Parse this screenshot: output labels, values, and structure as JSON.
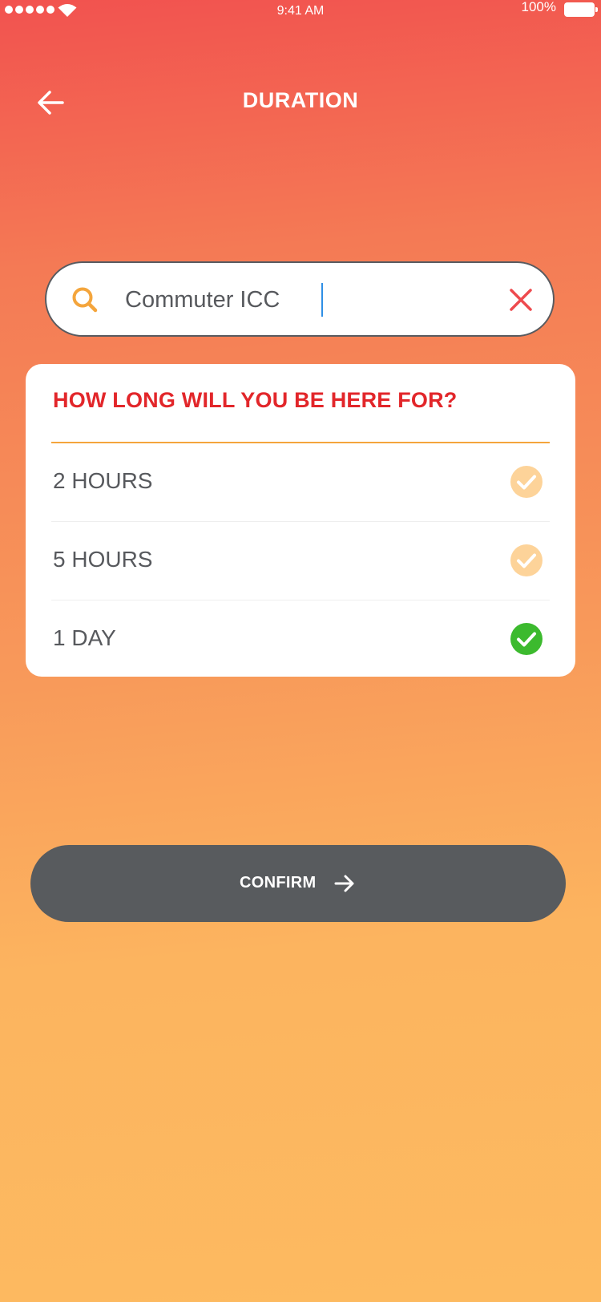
{
  "status_bar": {
    "time": "9:41 AM",
    "battery": "100%"
  },
  "header": {
    "title": "DURATION",
    "back_icon": "arrow-left-icon"
  },
  "search": {
    "value": "Commuter ICC",
    "search_icon": "search-icon",
    "clear_icon": "close-icon"
  },
  "duration_card": {
    "question": "HOW LONG WILL YOU BE HERE FOR?",
    "options": [
      {
        "label": "2 HOURS",
        "selected": false
      },
      {
        "label": "5 HOURS",
        "selected": false
      },
      {
        "label": "1 DAY",
        "selected": true
      }
    ]
  },
  "confirm": {
    "label": "CONFIRM",
    "icon": "arrow-right-icon"
  },
  "colors": {
    "gradient_top": "#f2524f",
    "gradient_bottom": "#fdba60",
    "accent_red": "#e2262a",
    "accent_orange": "#f4a53c",
    "check_unselected": "#fdd399",
    "check_selected": "#3cba2e",
    "button_dark": "#585b5e"
  }
}
